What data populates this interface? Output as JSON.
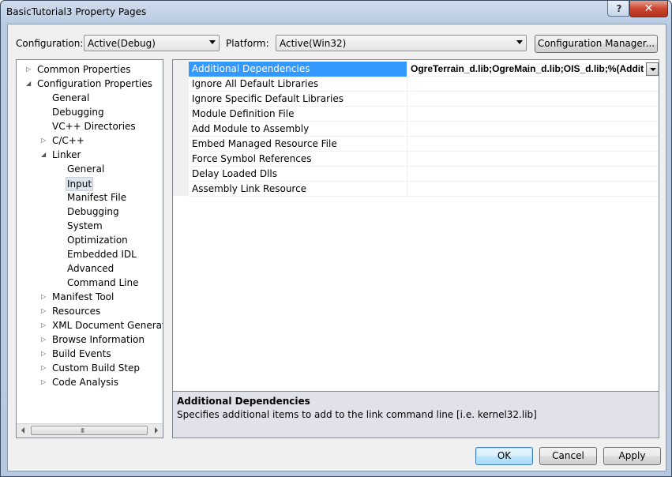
{
  "window": {
    "title": "BasicTutorial3 Property Pages",
    "close_glyph": "✕",
    "minimize_glyph": "?"
  },
  "toolbar": {
    "configuration_label": "Configuration:",
    "configuration_value": "Active(Debug)",
    "platform_label": "Platform:",
    "platform_value": "Active(Win32)",
    "config_manager_label": "Configuration Manager..."
  },
  "tree": {
    "items": [
      {
        "label": "Common Properties",
        "expander": "▷"
      },
      {
        "label": "Configuration Properties",
        "expander": "◢"
      },
      {
        "label": "General"
      },
      {
        "label": "Debugging"
      },
      {
        "label": "VC++ Directories"
      },
      {
        "label": "C/C++",
        "expander": "▷"
      },
      {
        "label": "Linker",
        "expander": "◢"
      },
      {
        "label": "General"
      },
      {
        "label": "Input",
        "selected": true
      },
      {
        "label": "Manifest File"
      },
      {
        "label": "Debugging"
      },
      {
        "label": "System"
      },
      {
        "label": "Optimization"
      },
      {
        "label": "Embedded IDL"
      },
      {
        "label": "Advanced"
      },
      {
        "label": "Command Line"
      },
      {
        "label": "Manifest Tool",
        "expander": "▷"
      },
      {
        "label": "Resources",
        "expander": "▷"
      },
      {
        "label": "XML Document Generator",
        "expander": "▷"
      },
      {
        "label": "Browse Information",
        "expander": "▷"
      },
      {
        "label": "Build Events",
        "expander": "▷"
      },
      {
        "label": "Custom Build Step",
        "expander": "▷"
      },
      {
        "label": "Code Analysis",
        "expander": "▷"
      }
    ],
    "scroll_grip": "III"
  },
  "properties": {
    "rows": [
      {
        "name": "Additional Dependencies",
        "value": "OgreTerrain_d.lib;OgreMain_d.lib;OIS_d.lib;%(Additiona",
        "selected": true
      },
      {
        "name": "Ignore All Default Libraries",
        "value": ""
      },
      {
        "name": "Ignore Specific Default Libraries",
        "value": ""
      },
      {
        "name": "Module Definition File",
        "value": ""
      },
      {
        "name": "Add Module to Assembly",
        "value": ""
      },
      {
        "name": "Embed Managed Resource File",
        "value": ""
      },
      {
        "name": "Force Symbol References",
        "value": ""
      },
      {
        "name": "Delay Loaded Dlls",
        "value": ""
      },
      {
        "name": "Assembly Link Resource",
        "value": ""
      }
    ]
  },
  "description": {
    "title": "Additional Dependencies",
    "text": "Specifies additional items to add to the link command line [i.e. kernel32.lib]"
  },
  "buttons": {
    "ok": "OK",
    "cancel": "Cancel",
    "apply": "Apply"
  }
}
